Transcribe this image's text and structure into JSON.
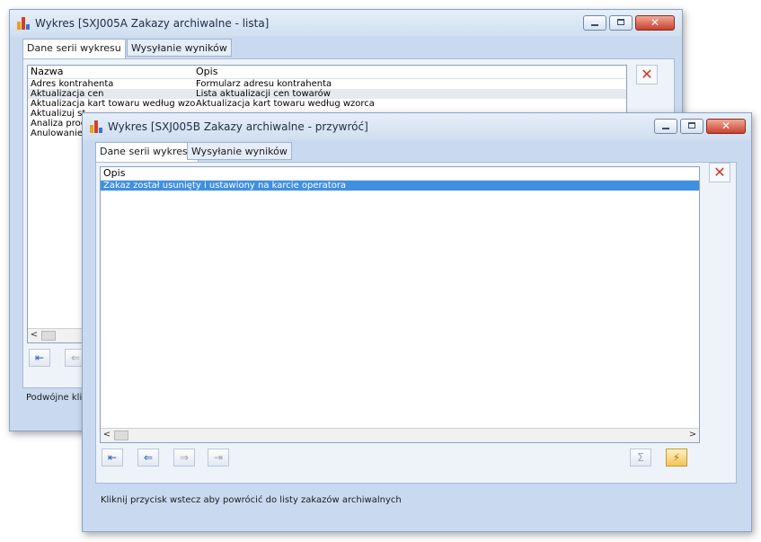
{
  "back_window": {
    "title": "Wykres [SXJ005A Zakazy archiwalne - lista]",
    "tabs": [
      {
        "label": "Dane serii wykresu",
        "active": true
      },
      {
        "label": "Wysyłanie wyników",
        "active": false
      }
    ],
    "grid": {
      "columns": [
        "Nazwa",
        "Opis"
      ],
      "rows": [
        {
          "nazwa": "Adres kontrahenta",
          "opis": "Formularz adresu kontrahenta"
        },
        {
          "nazwa": "Aktualizacja cen",
          "opis": "Lista aktualizacji cen towarów"
        },
        {
          "nazwa": "Aktualizacja kart towaru według wzor",
          "opis": "Aktualizacja kart towaru według wzorca"
        },
        {
          "nazwa": "Aktualizuj st",
          "opis": ""
        },
        {
          "nazwa": "Analiza proc",
          "opis": ""
        },
        {
          "nazwa": "Anulowanie",
          "opis": ""
        }
      ]
    },
    "delete_icon": "delete-x-icon",
    "status": "Podwójne kli"
  },
  "front_window": {
    "title": "Wykres [SXJ005B Zakazy archiwalne - przywróć]",
    "tabs": [
      {
        "label": "Dane serii wykresu",
        "active": true
      },
      {
        "label": "Wysyłanie wyników",
        "active": false
      }
    ],
    "grid": {
      "columns": [
        "Opis"
      ],
      "rows": [
        {
          "opis": "Zakaz został usunięty i ustawiony na karcie operatora",
          "selected": true
        }
      ]
    },
    "toolbar_icons": [
      "first-record-icon",
      "back-icon",
      "forward-icon",
      "last-record-icon",
      "sum-icon",
      "run-icon"
    ],
    "status": "Kliknij przycisk wstecz aby powrócić do listy zakazów archiwalnych"
  },
  "colors": {
    "selection": "#3f8fe2",
    "window_bg": "#c9daf0",
    "close_button": "#c9402c",
    "delete_icon": "#d6331f"
  }
}
